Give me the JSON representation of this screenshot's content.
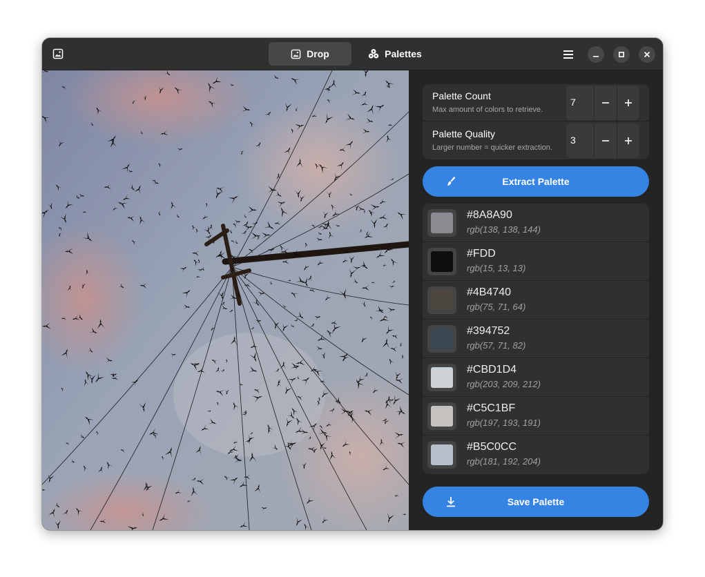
{
  "titlebar": {
    "tabs": [
      {
        "label": "Drop",
        "icon": "image-icon",
        "active": true
      },
      {
        "label": "Palettes",
        "icon": "palette-icon",
        "active": false
      }
    ]
  },
  "settings": {
    "count": {
      "title": "Palette Count",
      "subtitle": "Max amount of colors to retrieve.",
      "value": "7"
    },
    "quality": {
      "title": "Palette Quality",
      "subtitle": "Larger number = quicker extraction.",
      "value": "3"
    }
  },
  "extract_label": "Extract Palette",
  "save_label": "Save Palette",
  "colors": [
    {
      "hex": "#8A8A90",
      "rgb": "rgb(138, 138, 144)",
      "swatch": "#8A8A90"
    },
    {
      "hex": "#FDD",
      "rgb": "rgb(15, 13, 13)",
      "swatch": "#0F0D0D"
    },
    {
      "hex": "#4B4740",
      "rgb": "rgb(75, 71, 64)",
      "swatch": "#4B4740"
    },
    {
      "hex": "#394752",
      "rgb": "rgb(57, 71, 82)",
      "swatch": "#394752"
    },
    {
      "hex": "#CBD1D4",
      "rgb": "rgb(203, 209, 212)",
      "swatch": "#CBD1D4"
    },
    {
      "hex": "#C5C1BF",
      "rgb": "rgb(197, 193, 191)",
      "swatch": "#C5C1BF"
    },
    {
      "hex": "#B5C0CC",
      "rgb": "rgb(181, 192, 204)",
      "swatch": "#B5C0CC"
    }
  ],
  "accent_color": "#3584e4"
}
